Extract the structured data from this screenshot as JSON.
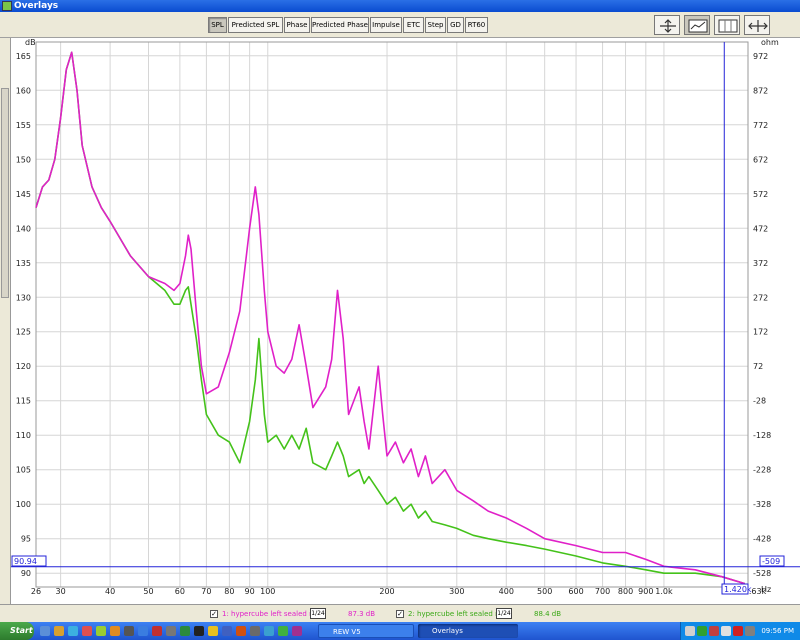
{
  "window": {
    "title": "Overlays"
  },
  "toolbar": {
    "tabs": [
      "SPL",
      "Predicted SPL",
      "Phase",
      "Predicted Phase",
      "Impulse",
      "ETC",
      "Step",
      "GD",
      "RT60"
    ],
    "active_tab": "SPL",
    "icons": [
      "vertical-zoom-icon",
      "graph-view-icon",
      "grid-view-icon",
      "horizontal-zoom-icon"
    ]
  },
  "plot": {
    "left_unit": "dB",
    "right_unit": "ohm",
    "x_unit": "Hz",
    "cursor_y_readout": "90.94",
    "cursor_x_readout": "1.420k",
    "cursor_right_readout": "-509",
    "left_ticks": [
      "165",
      "160",
      "155",
      "150",
      "145",
      "140",
      "135",
      "130",
      "125",
      "120",
      "115",
      "110",
      "105",
      "100",
      "95",
      "90"
    ],
    "right_ticks": [
      "972",
      "872",
      "772",
      "672",
      "572",
      "472",
      "372",
      "272",
      "172",
      "72",
      "-28",
      "-128",
      "-228",
      "-328",
      "-428",
      "-528"
    ],
    "x_ticks": [
      "26",
      "30",
      "40",
      "50",
      "60",
      "70",
      "80",
      "90",
      "100",
      "200",
      "300",
      "400",
      "500",
      "600",
      "700",
      "800",
      "900",
      "1.0k",
      "1.63k"
    ],
    "colors": {
      "trace1": "#e020c8",
      "trace2": "#44c21a",
      "cursor": "#2323d8",
      "grid": "#d6d6d6"
    }
  },
  "chart_data": {
    "type": "line",
    "xlabel": "Hz",
    "ylabel": "dB",
    "xscale": "log",
    "xlim": [
      26,
      1630
    ],
    "ylim": [
      88,
      167
    ],
    "series": [
      {
        "name": "1: hypercube left sealed ri",
        "x": [
          26,
          27,
          28,
          29,
          30,
          31,
          32,
          33,
          34,
          36,
          38,
          40,
          45,
          50,
          55,
          58,
          60,
          62,
          63,
          64,
          66,
          68,
          70,
          75,
          80,
          85,
          90,
          93,
          95,
          98,
          100,
          105,
          110,
          115,
          120,
          125,
          130,
          140,
          145,
          150,
          155,
          160,
          170,
          175,
          180,
          190,
          195,
          200,
          210,
          220,
          230,
          240,
          250,
          260,
          280,
          300,
          330,
          360,
          400,
          450,
          500,
          600,
          700,
          800,
          900,
          1000,
          1200,
          1400,
          1600
        ],
        "values": [
          143,
          146,
          147,
          150,
          156,
          163,
          165.5,
          160,
          152,
          146,
          143,
          141,
          136,
          133,
          132,
          131,
          132,
          136,
          139,
          137,
          128,
          120,
          116,
          117,
          122,
          128,
          140,
          146,
          142,
          131,
          125,
          120,
          119,
          121,
          126,
          120,
          114,
          117,
          121,
          131,
          124,
          113,
          117,
          112,
          108,
          120,
          113,
          107,
          109,
          106,
          108,
          104,
          107,
          103,
          105,
          102,
          100.5,
          99,
          98,
          96.5,
          95,
          94,
          93,
          93,
          92,
          91,
          90.5,
          89.5,
          88.5
        ]
      },
      {
        "name": "2: hypercube left sealed ri",
        "x": [
          26,
          27,
          28,
          29,
          30,
          31,
          32,
          33,
          34,
          36,
          38,
          40,
          45,
          50,
          55,
          58,
          60,
          62,
          63,
          64,
          66,
          68,
          70,
          75,
          80,
          85,
          90,
          93,
          95,
          98,
          100,
          105,
          110,
          115,
          120,
          125,
          130,
          140,
          145,
          150,
          155,
          160,
          170,
          175,
          180,
          190,
          195,
          200,
          210,
          220,
          230,
          240,
          250,
          260,
          280,
          300,
          330,
          360,
          400,
          450,
          500,
          600,
          700,
          800,
          900,
          1000,
          1200,
          1400,
          1600
        ],
        "values": [
          143,
          146,
          147,
          150,
          156,
          163,
          165.5,
          160,
          152,
          146,
          143,
          141,
          136,
          133,
          131,
          129,
          129,
          131,
          131.5,
          129,
          124,
          118,
          113,
          110,
          109,
          106,
          112,
          118,
          124,
          113,
          109,
          110,
          108,
          110,
          108,
          111,
          106,
          105,
          107,
          109,
          107,
          104,
          105,
          103,
          104,
          102,
          101,
          100,
          101,
          99,
          100,
          98,
          99,
          97.5,
          97,
          96.5,
          95.5,
          95,
          94.5,
          94,
          93.5,
          92.5,
          91.5,
          91,
          90.5,
          90,
          90,
          89.5,
          88.5
        ]
      }
    ]
  },
  "legend": {
    "items": [
      {
        "label": "1: hypercube left sealed ri",
        "smoothing": "1/24",
        "level": "87.3 dB",
        "color": "#e020c8"
      },
      {
        "label": "2: hypercube left sealed ri",
        "smoothing": "1/24",
        "level": "88.4 dB",
        "color": "#44c21a"
      }
    ]
  },
  "taskbar": {
    "start_label": "Start",
    "apps": [
      {
        "label": "REW V5"
      },
      {
        "label": "Overlays"
      }
    ],
    "clock": "09:56 PM"
  }
}
